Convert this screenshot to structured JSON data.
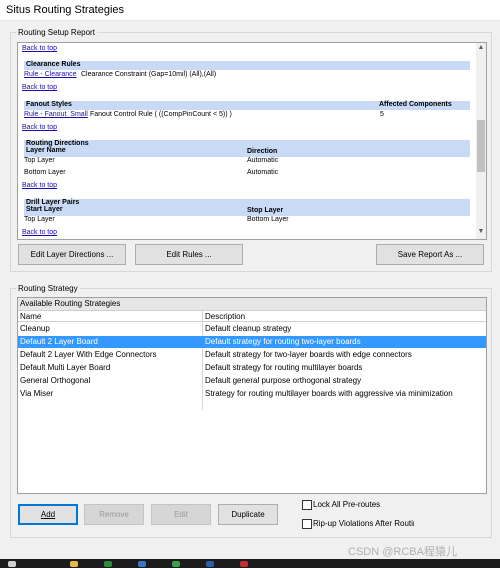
{
  "window": {
    "title": "Situs Routing Strategies"
  },
  "report": {
    "group_label": "Routing Setup Report",
    "back_to_top": "Back to top",
    "clearance": {
      "header": "Clearance Rules",
      "link": "Rule - Clearance",
      "text": "Clearance Constraint (Gap=10mil) (All),(All)"
    },
    "fanout": {
      "header": "Fanout Styles",
      "affected_header": "Affected Components",
      "link": "Rule - Fanout_Small",
      "text": "Fanout Control Rule ( ((CompPinCount < 5)) )",
      "count": "5"
    },
    "directions": {
      "header": "Routing Directions",
      "col_layer": "Layer Name",
      "col_direction": "Direction",
      "rows": [
        {
          "layer": "Top Layer",
          "direction": "Automatic"
        },
        {
          "layer": "Bottom Layer",
          "direction": "Automatic"
        }
      ]
    },
    "drill": {
      "header": "Drill Layer Pairs",
      "col_start": "Start Layer",
      "col_stop": "Stop Layer",
      "start": "Top Layer",
      "stop": "Bottom Layer"
    }
  },
  "report_buttons": {
    "edit_layer_directions": "Edit Layer Directions ...",
    "edit_rules": "Edit Rules ...",
    "save_report": "Save Report As ..."
  },
  "strategy": {
    "group_label": "Routing Strategy",
    "caption": "Available Routing Strategies",
    "col_name": "Name",
    "col_description": "Description",
    "rows": [
      {
        "name": "Cleanup",
        "description": "Default cleanup strategy"
      },
      {
        "name": "Default 2 Layer Board",
        "description": "Default strategy for routing two-layer boards"
      },
      {
        "name": "Default 2 Layer With Edge Connectors",
        "description": "Default strategy for two-layer boards with edge connectors"
      },
      {
        "name": "Default Multi Layer Board",
        "description": "Default strategy for routing multilayer boards"
      },
      {
        "name": "General Orthogonal",
        "description": "Default general purpose orthogonal strategy"
      },
      {
        "name": "Via Miser",
        "description": "Strategy for routing multilayer boards with aggressive via minimization"
      }
    ]
  },
  "strategy_buttons": {
    "add": "Add",
    "remove": "Remove",
    "edit": "Edit",
    "duplicate": "Duplicate"
  },
  "options": {
    "lock_preroutes": "Lock All Pre-routes",
    "ripup": "Rip-up Violations After Routing"
  },
  "watermark": "CSDN @RCBA程猿儿"
}
